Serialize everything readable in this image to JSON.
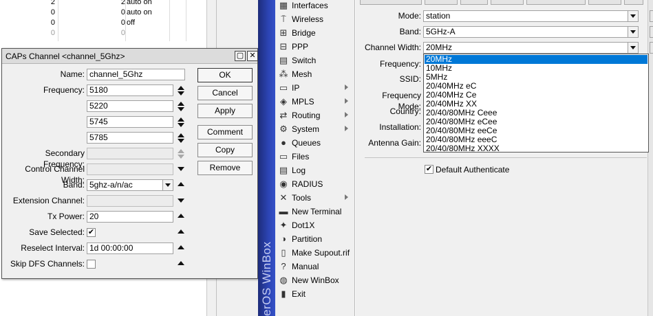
{
  "background_list": {
    "rows": [
      {
        "a": "2",
        "b": "2",
        "c": "auto on",
        "grey": false
      },
      {
        "a": "0",
        "b": "0",
        "c": "auto on",
        "grey": false
      },
      {
        "a": "0",
        "b": "0",
        "c": "off",
        "grey": false
      },
      {
        "a": "0",
        "b": "0",
        "c": "",
        "grey": true
      }
    ]
  },
  "caps_dialog": {
    "title": "CAPs Channel <channel_5Ghz>",
    "fields": {
      "name_label": "Name:",
      "name_value": "channel_5Ghz",
      "frequency_label": "Frequency:",
      "frequencies": [
        "5180",
        "5220",
        "5745",
        "5785"
      ],
      "secondary_frequency_label": "Secondary Frequency:",
      "control_channel_width_label": "Control Channel Width:",
      "band_label": "Band:",
      "band_value": "5ghz-a/n/ac",
      "extension_channel_label": "Extension Channel:",
      "tx_power_label": "Tx Power:",
      "tx_power_value": "20",
      "save_selected_label": "Save Selected:",
      "save_selected_checked": true,
      "reselect_interval_label": "Reselect Interval:",
      "reselect_interval_value": "1d 00:00:00",
      "skip_dfs_label": "Skip DFS Channels:",
      "skip_dfs_checked": false
    },
    "buttons": {
      "ok": "OK",
      "cancel": "Cancel",
      "apply": "Apply",
      "comment": "Comment",
      "copy": "Copy",
      "remove": "Remove"
    }
  },
  "winbox": {
    "vertical_text": "erOS WinBox",
    "accent": "#2c44b4"
  },
  "menu": {
    "items": [
      {
        "label": "Interfaces",
        "icon": "interfaces-icon",
        "glyph": "▦",
        "submenu": false
      },
      {
        "label": "Wireless",
        "icon": "wireless-icon",
        "glyph": "⍑",
        "submenu": false
      },
      {
        "label": "Bridge",
        "icon": "bridge-icon",
        "glyph": "⊞",
        "submenu": false
      },
      {
        "label": "PPP",
        "icon": "ppp-icon",
        "glyph": "⊟",
        "submenu": false
      },
      {
        "label": "Switch",
        "icon": "switch-icon",
        "glyph": "▤",
        "submenu": false
      },
      {
        "label": "Mesh",
        "icon": "mesh-icon",
        "glyph": "⁂",
        "submenu": false
      },
      {
        "label": "IP",
        "icon": "ip-icon",
        "glyph": "▭",
        "submenu": true
      },
      {
        "label": "MPLS",
        "icon": "mpls-icon",
        "glyph": "◈",
        "submenu": true
      },
      {
        "label": "Routing",
        "icon": "routing-icon",
        "glyph": "⇄",
        "submenu": true
      },
      {
        "label": "System",
        "icon": "system-icon",
        "glyph": "⚙",
        "submenu": true
      },
      {
        "label": "Queues",
        "icon": "queues-icon",
        "glyph": "●",
        "submenu": false
      },
      {
        "label": "Files",
        "icon": "files-icon",
        "glyph": "▭",
        "submenu": false
      },
      {
        "label": "Log",
        "icon": "log-icon",
        "glyph": "▤",
        "submenu": false
      },
      {
        "label": "RADIUS",
        "icon": "radius-icon",
        "glyph": "◉",
        "submenu": false
      },
      {
        "label": "Tools",
        "icon": "tools-icon",
        "glyph": "✕",
        "submenu": true
      },
      {
        "label": "New Terminal",
        "icon": "terminal-icon",
        "glyph": "▬",
        "submenu": false
      },
      {
        "label": "Dot1X",
        "icon": "dot1x-icon",
        "glyph": "✦",
        "submenu": false
      },
      {
        "label": "Partition",
        "icon": "partition-icon",
        "glyph": "◑",
        "submenu": false
      },
      {
        "label": "Make Supout.rif",
        "icon": "supout-icon",
        "glyph": "▯",
        "submenu": false
      },
      {
        "label": "Manual",
        "icon": "manual-icon",
        "glyph": "?",
        "submenu": false
      },
      {
        "label": "New WinBox",
        "icon": "new-winbox-icon",
        "glyph": "◍",
        "submenu": false
      },
      {
        "label": "Exit",
        "icon": "exit-icon",
        "glyph": "▮",
        "submenu": false
      }
    ]
  },
  "wireless_window": {
    "mode_label": "Mode:",
    "mode_value": "station",
    "band_label": "Band:",
    "band_value": "5GHz-A",
    "channel_width_label": "Channel Width:",
    "channel_width_value": "20MHz",
    "frequency_label": "Frequency:",
    "ssid_label": "SSID:",
    "frequency_mode_label": "Frequency Mode:",
    "country_label": "Country:",
    "installation_label": "Installation:",
    "antenna_gain_label": "Antenna Gain:",
    "channel_width_options": [
      "20MHz",
      "10MHz",
      "5MHz",
      "20/40MHz eC",
      "20/40MHz Ce",
      "20/40MHz XX",
      "20/40/80MHz Ceee",
      "20/40/80MHz eCee",
      "20/40/80MHz eeCe",
      "20/40/80MHz eeeC",
      "20/40/80MHz XXXX"
    ],
    "selected_option_index": 0,
    "default_authenticate_label": "Default Authenticate",
    "default_authenticate_checked": true,
    "selection_color": "#0078d7"
  }
}
